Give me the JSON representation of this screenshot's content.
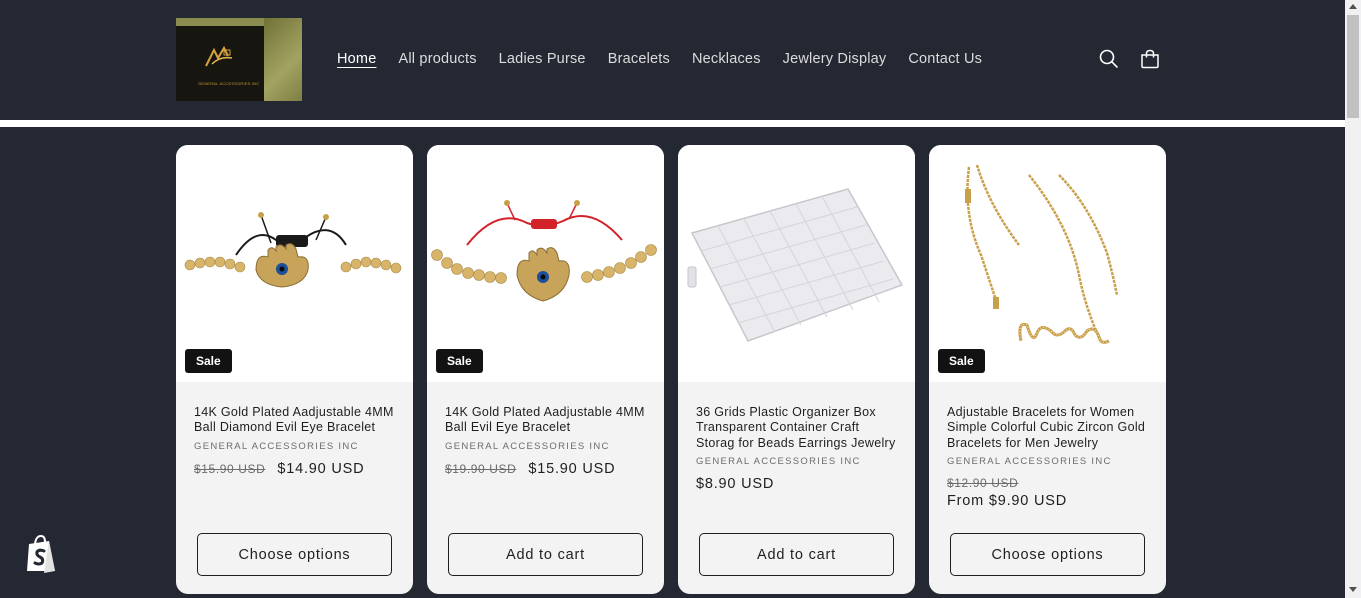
{
  "logo": {
    "tagline": "GENERAL ACCESSORIES INC"
  },
  "nav": [
    {
      "label": "Home",
      "active": true
    },
    {
      "label": "All products"
    },
    {
      "label": "Ladies Purse"
    },
    {
      "label": "Bracelets"
    },
    {
      "label": "Necklaces"
    },
    {
      "label": "Jewlery Display"
    },
    {
      "label": "Contact Us"
    }
  ],
  "icons": {
    "search": "search-icon",
    "cart": "cart-icon",
    "shopify": "shopify-bag-icon"
  },
  "products": [
    {
      "title": "14K Gold Plated Aadjustable 4MM Ball Diamond Evil Eye Bracelet",
      "vendor": "GENERAL ACCESSORIES INC",
      "badge": "Sale",
      "compare_price": "$15.90 USD",
      "price": "$14.90 USD",
      "button": "Choose options"
    },
    {
      "title": "14K Gold Plated Aadjustable 4MM Ball Evil Eye Bracelet",
      "vendor": "GENERAL ACCESSORIES INC",
      "badge": "Sale",
      "compare_price": "$19.90 USD",
      "price": "$15.90 USD",
      "button": "Add to cart"
    },
    {
      "title": "36 Grids Plastic Organizer Box Transparent Container Craft Storag for Beads Earrings Jewelry",
      "vendor": "GENERAL ACCESSORIES INC",
      "price": "$8.90 USD",
      "button": "Add to cart"
    },
    {
      "title": "Adjustable Bracelets for Women Simple Colorful Cubic Zircon Gold Bracelets for Men Jewelry",
      "vendor": "GENERAL ACCESSORIES INC",
      "badge": "Sale",
      "compare_price": "$12.90 USD",
      "price": "From $9.90 USD",
      "button": "Choose options"
    }
  ],
  "colors": {
    "header_bg": "#242833",
    "card_bg": "#f3f3f3",
    "badge_bg": "#121212",
    "accent_gold": "#c9a04a"
  }
}
